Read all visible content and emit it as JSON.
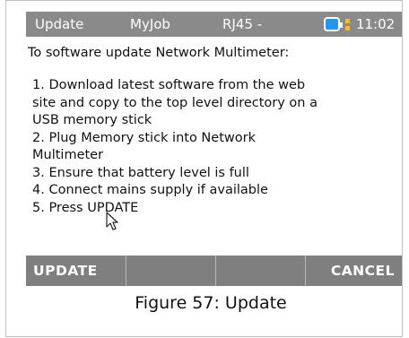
{
  "statusbar": {
    "mode": "Update",
    "job": "MyJob",
    "port": "RJ45 -",
    "battery_icon": "battery-icon",
    "time": "11:02",
    "colors": {
      "bar": "#8a8a8a",
      "battery": "#2196f3",
      "indicator": "#f5c400"
    }
  },
  "content": {
    "intro": "To software update Network Multimeter:",
    "steps": [
      "1. Download latest software from the web",
      "site and copy to the top level directory on a",
      "USB memory stick",
      "2. Plug Memory stick into Network",
      "Multimeter",
      "3. Ensure that battery level is full",
      "4. Connect mains supply if available",
      "5. Press UPDATE"
    ]
  },
  "softkeys": {
    "key1": "UPDATE",
    "key2": "",
    "key3": "",
    "key4": "CANCEL"
  },
  "caption": "Figure 57: Update"
}
